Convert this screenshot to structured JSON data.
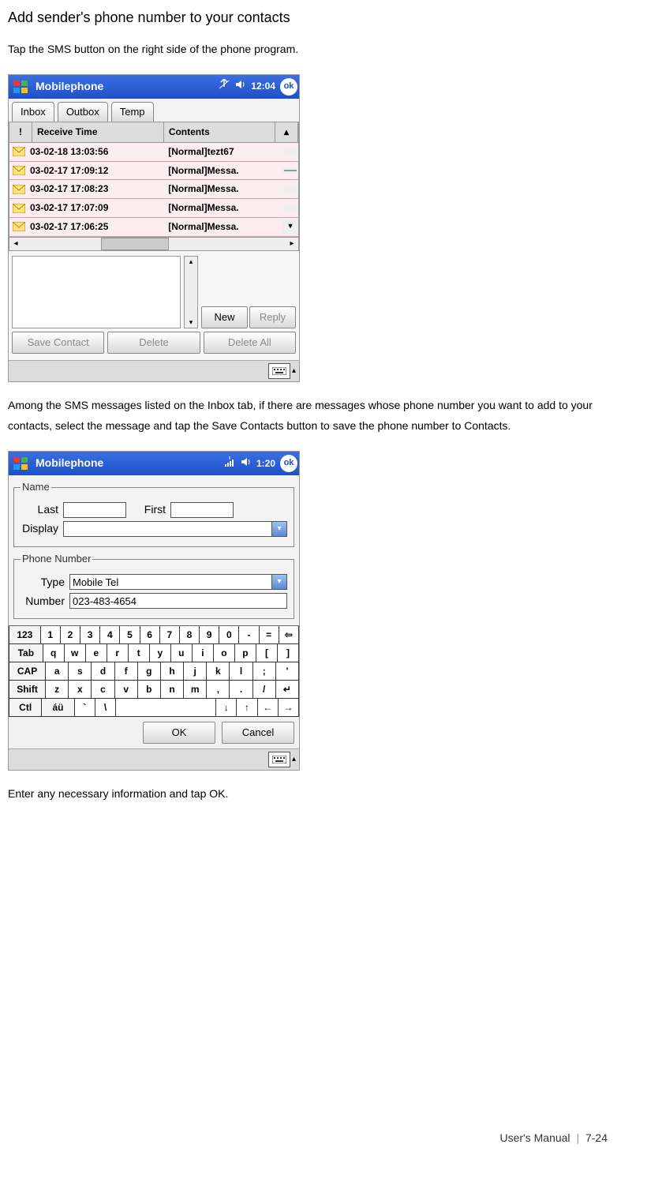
{
  "heading": "Add sender's phone number to your contacts",
  "intro": "Tap the SMS button on the right side of the phone program.",
  "middle_para": "Among the SMS messages listed on the Inbox tab, if there are messages whose phone number you want to add to your contacts, select the message and tap the Save Contacts button to save the phone number to Contacts.",
  "closing": "Enter any necessary information and tap OK.",
  "footer": {
    "manual": "User's Manual",
    "page": "7-24"
  },
  "shot1": {
    "title": "Mobilephone",
    "time": "12:04",
    "ok": "ok",
    "tabs": {
      "inbox": "Inbox",
      "outbox": "Outbox",
      "temp": "Temp"
    },
    "thead": {
      "bang": "!",
      "time": "Receive Time",
      "contents": "Contents"
    },
    "rows": [
      {
        "time": "03-02-18 13:03:56",
        "contents": "[Normal]tezt67"
      },
      {
        "time": "03-02-17 17:09:12",
        "contents": "[Normal]Messa."
      },
      {
        "time": "03-02-17 17:08:23",
        "contents": "[Normal]Messa."
      },
      {
        "time": "03-02-17 17:07:09",
        "contents": "[Normal]Messa."
      },
      {
        "time": "03-02-17 17:06:25",
        "contents": "[Normal]Messa."
      }
    ],
    "buttons": {
      "new": "New",
      "reply": "Reply",
      "save_contact": "Save Contact",
      "delete": "Delete",
      "delete_all": "Delete All"
    }
  },
  "shot2": {
    "title": "Mobilephone",
    "time": "1:20",
    "ok": "ok",
    "name_legend": "Name",
    "last_label": "Last",
    "first_label": "First",
    "display_label": "Display",
    "last_value": "",
    "first_value": "",
    "display_value": "",
    "phone_legend": "Phone Number",
    "type_label": "Type",
    "type_value": "Mobile Tel",
    "number_label": "Number",
    "number_value": "023-483-4654",
    "ok_btn": "OK",
    "cancel_btn": "Cancel",
    "osk": {
      "r1": [
        "123",
        "1",
        "2",
        "3",
        "4",
        "5",
        "6",
        "7",
        "8",
        "9",
        "0",
        "-",
        "=",
        "⇦"
      ],
      "r2": [
        "Tab",
        "q",
        "w",
        "e",
        "r",
        "t",
        "y",
        "u",
        "i",
        "o",
        "p",
        "[",
        "]"
      ],
      "r3": [
        "CAP",
        "a",
        "s",
        "d",
        "f",
        "g",
        "h",
        "j",
        "k",
        "l",
        ";",
        "'"
      ],
      "r4": [
        "Shift",
        "z",
        "x",
        "c",
        "v",
        "b",
        "n",
        "m",
        ",",
        ".",
        "/",
        "↵"
      ],
      "r5": [
        "Ctl",
        "áü",
        "`",
        "\\",
        " ",
        "↓",
        "↑",
        "←",
        "→"
      ]
    }
  }
}
